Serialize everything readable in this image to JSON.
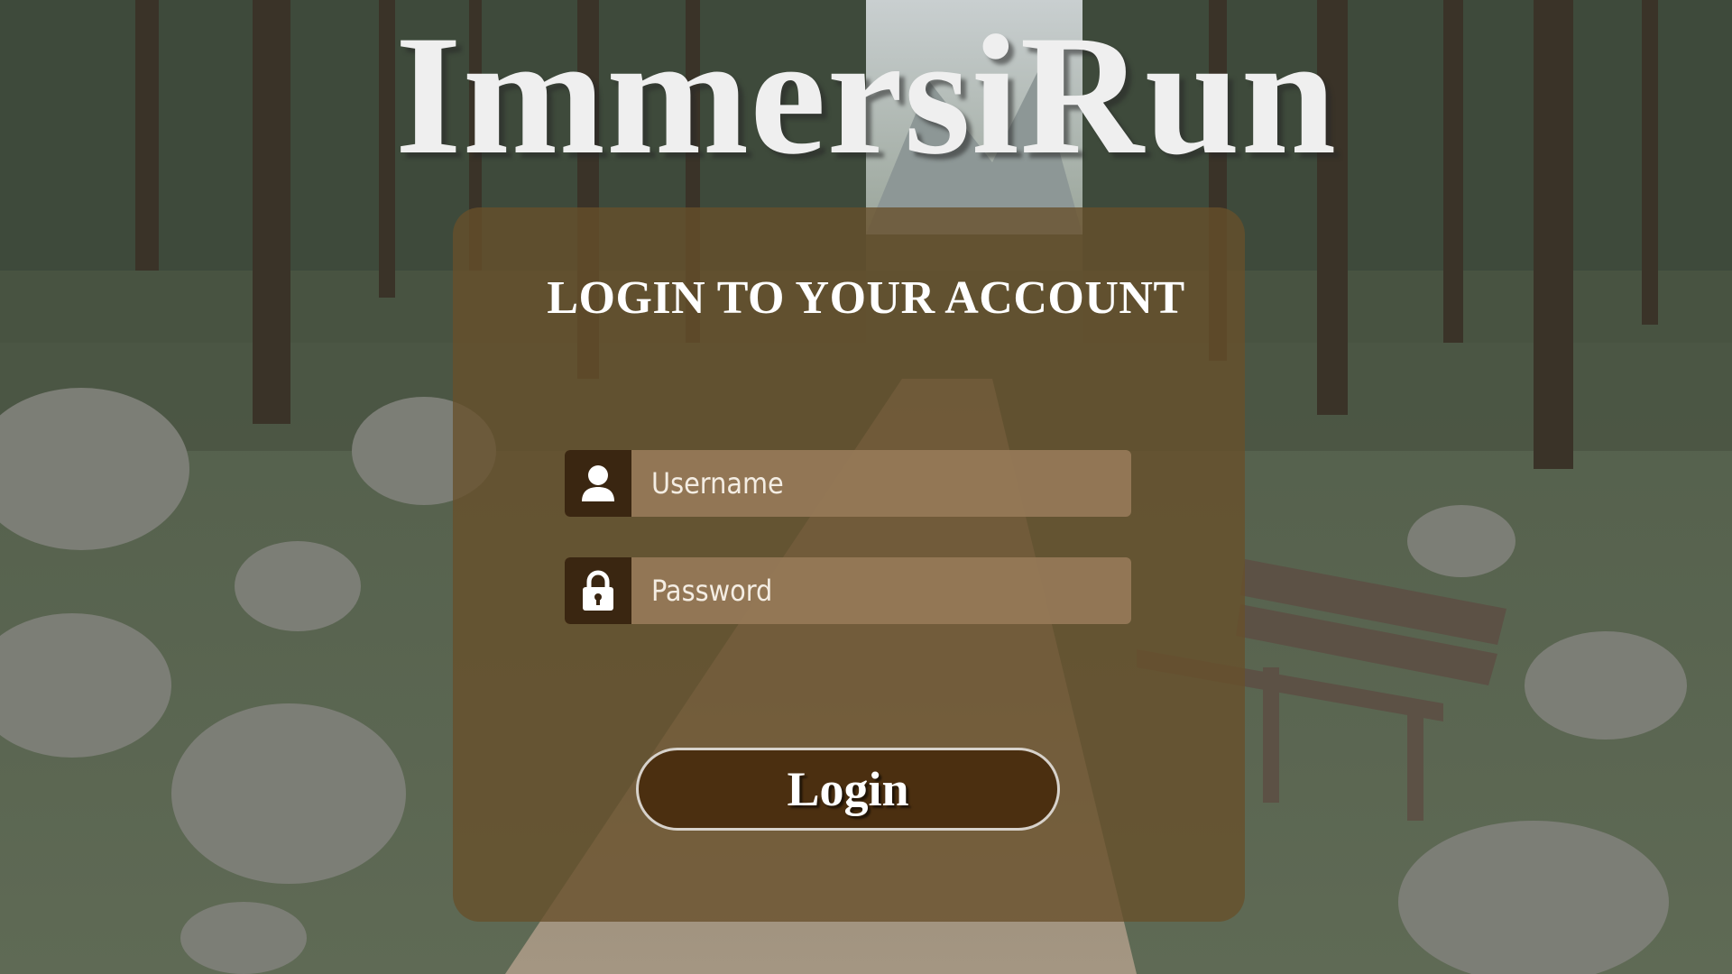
{
  "app": {
    "title": "ImmersiRun"
  },
  "login_card": {
    "heading": "LOGIN TO YOUR ACCOUNT",
    "username": {
      "placeholder": "Username",
      "value": "",
      "icon": "user-icon"
    },
    "password": {
      "placeholder": "Password",
      "value": "",
      "icon": "lock-icon"
    },
    "submit_label": "Login"
  },
  "colors": {
    "card_background": "#68502a",
    "icon_box": "#3a2611",
    "input_background": "#967a58",
    "button_background": "#4b2f10",
    "button_border": "#d7d2cb",
    "title_text": "#efefef"
  }
}
